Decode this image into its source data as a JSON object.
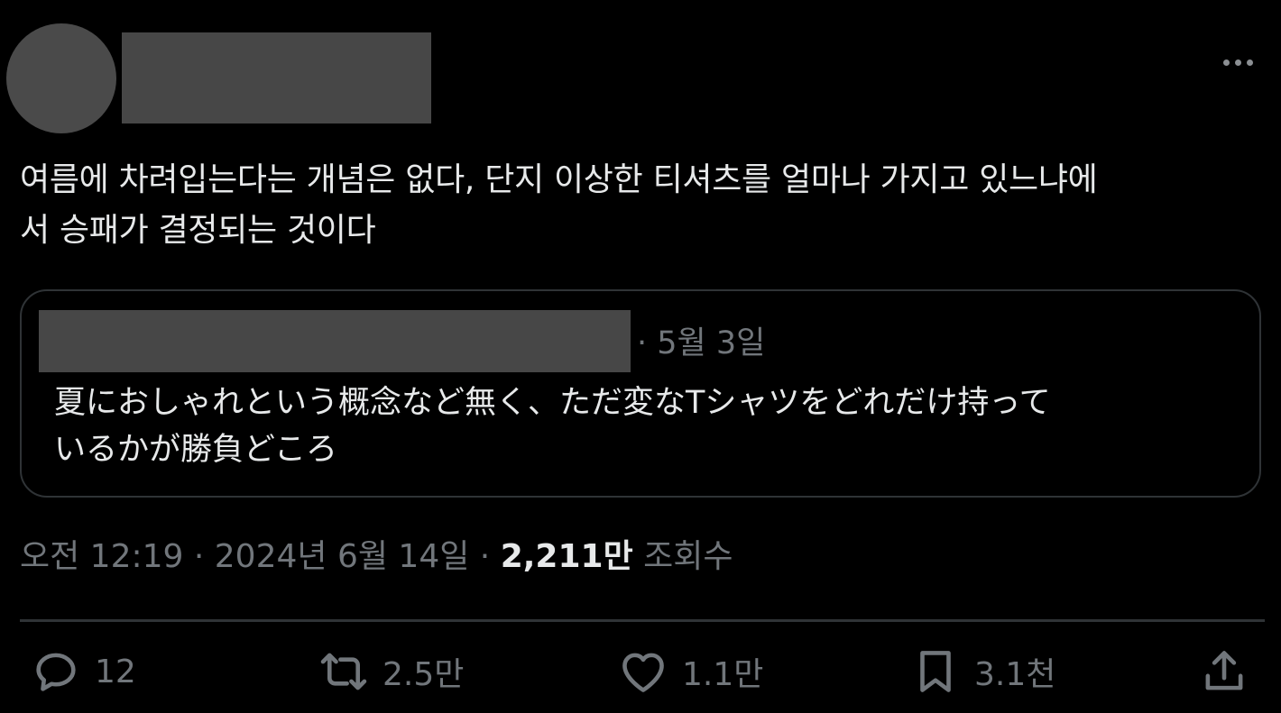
{
  "tweet": {
    "text": "여름에 차려입는다는 개념은 없다, 단지 이상한 티셔츠를 얼마나 가지고 있느냐에\n서 승패가 결정되는 것이다"
  },
  "quote": {
    "date": "· 5월 3일",
    "text": "夏におしゃれという概念など無く、ただ変なTシャツをどれだけ持って\nいるかが勝負どころ"
  },
  "meta": {
    "time": "오전 12:19",
    "separator": " · ",
    "date": "2024년 6월 14일",
    "views_count": "2,211만",
    "views_label": " 조회수"
  },
  "actions": {
    "reply_icon": "reply-icon",
    "reply_count": "12",
    "retweet_icon": "retweet-icon",
    "retweet_count": "2.5만",
    "like_icon": "heart-icon",
    "like_count": "1.1만",
    "bookmark_icon": "bookmark-icon",
    "bookmark_count": "3.1천",
    "share_icon": "share-icon"
  },
  "colors": {
    "background": "#000000",
    "text": "#e7e9ea",
    "secondary": "#71767b",
    "border": "#2f3336",
    "redaction": "#474747"
  }
}
